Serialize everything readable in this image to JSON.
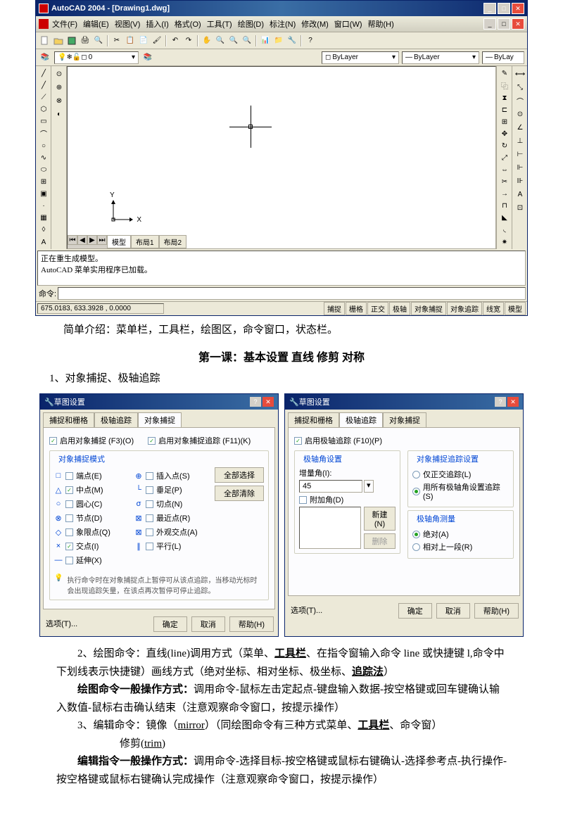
{
  "acad": {
    "title": "AutoCAD 2004 - [Drawing1.dwg]",
    "menu": [
      "文件(F)",
      "编辑(E)",
      "视图(V)",
      "插入(I)",
      "格式(O)",
      "工具(T)",
      "绘图(D)",
      "标注(N)",
      "修改(M)",
      "窗口(W)",
      "帮助(H)"
    ],
    "layer_dropdown": "0",
    "bylayer1": "ByLayer",
    "bylayer2": "ByLayer",
    "bylayer3": "ByLay",
    "tabs_nav": [
      "⏮",
      "◀",
      "▶",
      "⏭"
    ],
    "tabs": [
      "模型",
      "布局1",
      "布局2"
    ],
    "ucs_x": "X",
    "ucs_y": "Y",
    "cmd_text1": "正在重生成模型。",
    "cmd_text2": "AutoCAD 菜单实用程序已加载。",
    "cmd_label": "命令:",
    "coords": "675.0183, 633.3928 , 0.0000",
    "status_btns": [
      "捕捉",
      "栅格",
      "正交",
      "极轴",
      "对象捕捉",
      "对象追踪",
      "线宽",
      "模型"
    ]
  },
  "intro": "简单介绍：菜单栏，工具栏，绘图区，命令窗口，状态栏。",
  "lesson_title": "第一课：基本设置  直线  修剪  对称",
  "item1": "1、对象捕捉、极轴追踪",
  "dlg1": {
    "title": "草图设置",
    "tabs": [
      "捕捉和栅格",
      "极轴追踪",
      "对象捕捉"
    ],
    "enable_osnap": "启用对象捕捉 (F3)(O)",
    "enable_otrack": "启用对象捕捉追踪 (F11)(K)",
    "mode_title": "对象捕捉模式",
    "snaps_left": [
      {
        "icon": "□",
        "label": "端点(E)",
        "on": false
      },
      {
        "icon": "△",
        "label": "中点(M)",
        "on": true
      },
      {
        "icon": "○",
        "label": "圆心(C)",
        "on": false
      },
      {
        "icon": "⊗",
        "label": "节点(D)",
        "on": false
      },
      {
        "icon": "◇",
        "label": "象限点(Q)",
        "on": false
      },
      {
        "icon": "×",
        "label": "交点(I)",
        "on": true
      },
      {
        "icon": "—",
        "label": "延伸(X)",
        "on": false
      }
    ],
    "snaps_right": [
      {
        "icon": "⊕",
        "label": "插入点(S)",
        "on": false
      },
      {
        "icon": "└",
        "label": "垂足(P)",
        "on": false
      },
      {
        "icon": "σ",
        "label": "切点(N)",
        "on": false
      },
      {
        "icon": "⊠",
        "label": "最近点(R)",
        "on": false
      },
      {
        "icon": "⊠",
        "label": "外观交点(A)",
        "on": false
      },
      {
        "icon": "∥",
        "label": "平行(L)",
        "on": false
      }
    ],
    "btn_all": "全部选择",
    "btn_clear": "全部清除",
    "tip": "执行命令时在对象捕捉点上暂停可从该点追踪，当移动光标时会出现追踪矢量，在该点再次暂停可停止追踪。",
    "options": "选项(T)...",
    "ok": "确定",
    "cancel": "取消",
    "help": "帮助(H)"
  },
  "dlg2": {
    "title": "草图设置",
    "tabs": [
      "捕捉和栅格",
      "极轴追踪",
      "对象捕捉"
    ],
    "enable_polar": "启用极轴追踪 (F10)(P)",
    "angle_title": "极轴角设置",
    "inc_label": "增量角(I):",
    "inc_value": "45",
    "add_angle": "附加角(D)",
    "btn_new": "新建(N)",
    "btn_del": "删除",
    "track_title": "对象捕捉追踪设置",
    "track_ortho": "仅正交追踪(L)",
    "track_all": "用所有极轴角设置追踪(S)",
    "measure_title": "极轴角测量",
    "abs": "绝对(A)",
    "rel": "相对上一段(R)",
    "options": "选项(T)...",
    "ok": "确定",
    "cancel": "取消",
    "help": "帮助(H)"
  },
  "para2_a": "2、绘图命令：直线(line)调用方式（菜单、",
  "para2_b": "工具栏",
  "para2_c": "、在指令窗输入命令 line 或快捷键 l,命令中下划线表示快捷键）画线方式（绝对坐标、相对坐标、极坐标、",
  "para2_d": "追踪法",
  "para2_e": "）",
  "para3_a": "绘图命令一般操作方式：",
  "para3_b": "调用命令-鼠标左击定起点-键盘输入数据-按空格键或回车键确认输入数值-鼠标右击确认结束（注意观察命令窗口，按提示操作）",
  "para4_a": "3、编辑命令：镜像（",
  "para4_b": "mirror",
  "para4_c": "）（同绘图命令有三种方式菜单、",
  "para4_d": "工具栏",
  "para4_e": "、命令窗）",
  "para5_a": "修剪(",
  "para5_b": "trim",
  "para5_c": ")",
  "para6_a": "编辑指令一般操作方式：",
  "para6_b": "调用命令-选择目标-按空格键或鼠标右键确认-选择参考点-执行操作-按空格键或鼠标右键确认完成操作（注意观察命令窗口，按提示操作）"
}
